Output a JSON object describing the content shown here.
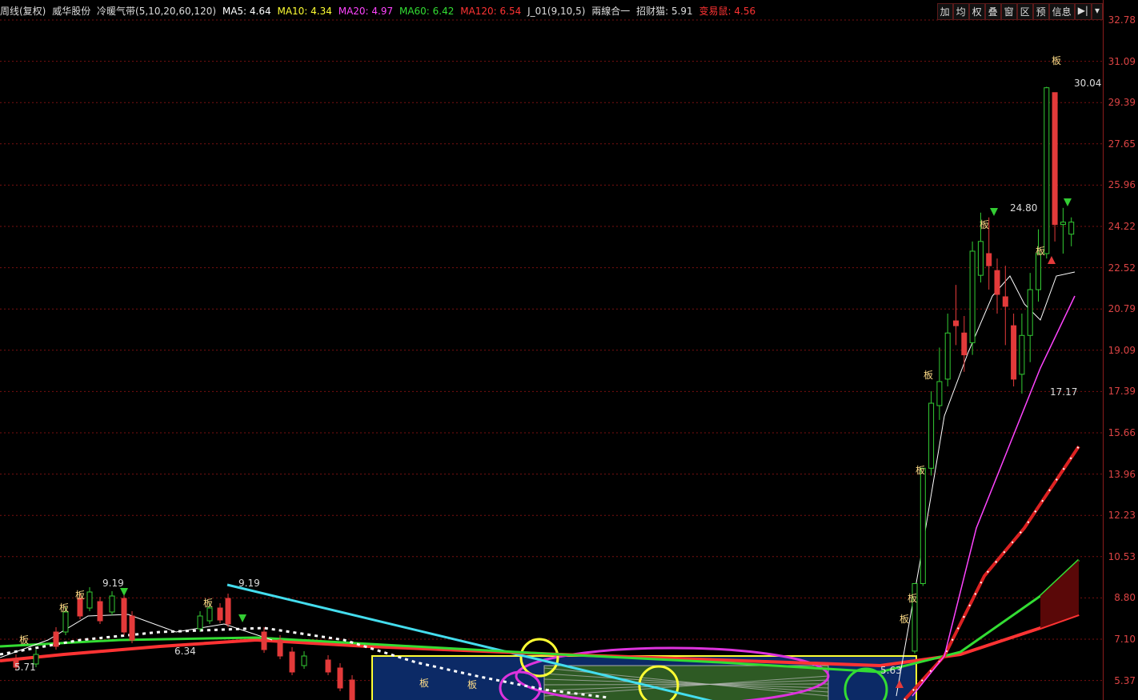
{
  "header": {
    "period": "周线(复权)",
    "stock_name": "威华股份",
    "indicator_name": "冷暖气带(5,10,20,60,120)",
    "ma5_label": "MA5: 4.64",
    "ma10_label": "MA10: 4.34",
    "ma20_label": "MA20: 4.97",
    "ma60_label": "MA60: 6.42",
    "ma120_label": "MA120: 6.54",
    "j01_label": "J_01(9,10,5)",
    "strategy_label": "兩線合一",
    "zcm_label": "招财猫: 5.91",
    "byr_label": "变易鼠: 4.56"
  },
  "colors": {
    "ma5": "#ffffff",
    "ma10": "#ffff33",
    "ma20": "#ff44ff",
    "ma60": "#33dd33",
    "ma120": "#ff3333",
    "up": "#e33a3a",
    "down": "#33cc33",
    "grid": "#7a1010",
    "trend": "#44ddee",
    "box": "#ffff33"
  },
  "toolbar": {
    "items": [
      "加",
      "均",
      "权",
      "叠",
      "窗",
      "区",
      "预",
      "信息"
    ],
    "right_icons": [
      "collapse-icon",
      "dropdown-icon"
    ]
  },
  "axis_ticks": [
    "32.78",
    "31.09",
    "29.39",
    "27.65",
    "25.96",
    "24.22",
    "22.52",
    "20.79",
    "19.09",
    "17.39",
    "15.66",
    "13.96",
    "12.23",
    "10.53",
    "8.80",
    "7.10",
    "5.37"
  ],
  "chart_data": {
    "type": "candlestick",
    "ylim": [
      5.37,
      32.78
    ],
    "annotations": [
      {
        "text": "9.19",
        "value": 9.19
      },
      {
        "text": "9.19",
        "value": 9.19
      },
      {
        "text": "6.34",
        "value": 6.34
      },
      {
        "text": "5.71",
        "value": 5.71
      },
      {
        "text": "5.63",
        "value": 5.63
      },
      {
        "text": "30.04",
        "value": 30.04
      },
      {
        "text": "24.80",
        "value": 24.8
      },
      {
        "text": "17.17",
        "value": 17.17
      }
    ],
    "board_marker": "板",
    "recent_candles": [
      {
        "open": 6.6,
        "close": 9.4,
        "high": 9.4,
        "low": 6.5
      },
      {
        "open": 9.4,
        "close": 14.2,
        "high": 14.2,
        "low": 9.3
      },
      {
        "open": 14.2,
        "close": 16.9,
        "high": 17.4,
        "low": 13.9
      },
      {
        "open": 16.8,
        "close": 17.8,
        "high": 19.2,
        "low": 16.2
      },
      {
        "open": 17.9,
        "close": 19.8,
        "high": 20.6,
        "low": 17.6
      },
      {
        "open": 20.3,
        "close": 20.1,
        "high": 21.8,
        "low": 19.3
      },
      {
        "open": 19.8,
        "close": 18.9,
        "high": 20.5,
        "low": 18.2
      },
      {
        "open": 19.4,
        "close": 23.2,
        "high": 23.6,
        "low": 18.9
      },
      {
        "open": 22.2,
        "close": 23.6,
        "high": 24.8,
        "low": 21.9
      },
      {
        "open": 23.1,
        "close": 22.6,
        "high": 24.6,
        "low": 21.6
      },
      {
        "open": 22.4,
        "close": 21.4,
        "high": 22.9,
        "low": 20.6
      },
      {
        "open": 21.3,
        "close": 20.9,
        "high": 22.6,
        "low": 19.3
      },
      {
        "open": 20.1,
        "close": 17.9,
        "high": 20.6,
        "low": 17.6
      },
      {
        "open": 18.1,
        "close": 19.7,
        "high": 20.6,
        "low": 17.3
      },
      {
        "open": 19.7,
        "close": 21.6,
        "high": 22.3,
        "low": 18.6
      },
      {
        "open": 21.6,
        "close": 23.1,
        "high": 24.1,
        "low": 21.1
      },
      {
        "open": 23.1,
        "close": 30.0,
        "high": 30.04,
        "low": 22.9
      },
      {
        "open": 29.8,
        "close": 24.3,
        "high": 29.8,
        "low": 23.6
      },
      {
        "open": 24.3,
        "close": 24.4,
        "high": 25.0,
        "low": 23.1
      },
      {
        "open": 23.9,
        "close": 24.4,
        "high": 24.6,
        "low": 23.4
      }
    ]
  }
}
